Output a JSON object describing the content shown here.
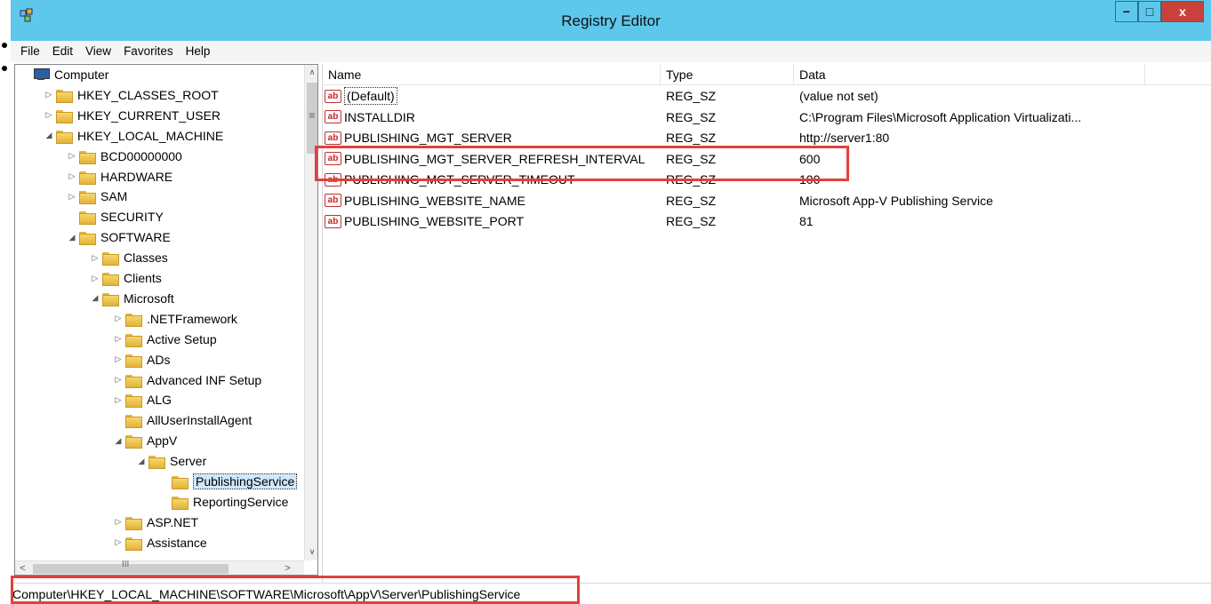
{
  "window": {
    "title": "Registry Editor",
    "minimize": "−",
    "maximize": "□",
    "close": "x",
    "accent_color": "#5ec8ec",
    "highlight_color": "#e2403b"
  },
  "menu": [
    "File",
    "Edit",
    "View",
    "Favorites",
    "Help"
  ],
  "tree": [
    {
      "label": "Computer",
      "level": 0,
      "expander": "",
      "icon": "computer-icon"
    },
    {
      "label": "HKEY_CLASSES_ROOT",
      "level": 1,
      "expander": "▷",
      "icon": "folder-icon"
    },
    {
      "label": "HKEY_CURRENT_USER",
      "level": 1,
      "expander": "▷",
      "icon": "folder-icon"
    },
    {
      "label": "HKEY_LOCAL_MACHINE",
      "level": 1,
      "expander": "◢",
      "icon": "folder-icon"
    },
    {
      "label": "BCD00000000",
      "level": 2,
      "expander": "▷",
      "icon": "folder-icon"
    },
    {
      "label": "HARDWARE",
      "level": 2,
      "expander": "▷",
      "icon": "folder-icon"
    },
    {
      "label": "SAM",
      "level": 2,
      "expander": "▷",
      "icon": "folder-icon"
    },
    {
      "label": "SECURITY",
      "level": 2,
      "expander": "",
      "icon": "folder-icon"
    },
    {
      "label": "SOFTWARE",
      "level": 2,
      "expander": "◢",
      "icon": "folder-icon"
    },
    {
      "label": "Classes",
      "level": 3,
      "expander": "▷",
      "icon": "folder-icon"
    },
    {
      "label": "Clients",
      "level": 3,
      "expander": "▷",
      "icon": "folder-icon"
    },
    {
      "label": "Microsoft",
      "level": 3,
      "expander": "◢",
      "icon": "folder-icon"
    },
    {
      "label": ".NETFramework",
      "level": 4,
      "expander": "▷",
      "icon": "folder-icon"
    },
    {
      "label": "Active Setup",
      "level": 4,
      "expander": "▷",
      "icon": "folder-icon"
    },
    {
      "label": "ADs",
      "level": 4,
      "expander": "▷",
      "icon": "folder-icon"
    },
    {
      "label": "Advanced INF Setup",
      "level": 4,
      "expander": "▷",
      "icon": "folder-icon"
    },
    {
      "label": "ALG",
      "level": 4,
      "expander": "▷",
      "icon": "folder-icon"
    },
    {
      "label": "AllUserInstallAgent",
      "level": 4,
      "expander": "",
      "icon": "folder-icon"
    },
    {
      "label": "AppV",
      "level": 4,
      "expander": "◢",
      "icon": "folder-icon"
    },
    {
      "label": "Server",
      "level": 5,
      "expander": "◢",
      "icon": "folder-icon"
    },
    {
      "label": "PublishingService",
      "level": 6,
      "expander": "",
      "icon": "folder-icon",
      "selected": true
    },
    {
      "label": "ReportingService",
      "level": 6,
      "expander": "",
      "icon": "folder-icon"
    },
    {
      "label": "ASP.NET",
      "level": 4,
      "expander": "▷",
      "icon": "folder-icon"
    },
    {
      "label": "Assistance",
      "level": 4,
      "expander": "▷",
      "icon": "folder-icon"
    }
  ],
  "tree_scroll": {
    "up": "∧",
    "down": "∨",
    "left": "<",
    "right": ">",
    "grip_v": "≡",
    "grip_h": "III"
  },
  "list": {
    "columns": [
      "Name",
      "Type",
      "Data"
    ],
    "rows": [
      {
        "name": "(Default)",
        "type": "REG_SZ",
        "data": "(value not set)"
      },
      {
        "name": "INSTALLDIR",
        "type": "REG_SZ",
        "data": "C:\\Program Files\\Microsoft Application Virtualizati..."
      },
      {
        "name": "PUBLISHING_MGT_SERVER",
        "type": "REG_SZ",
        "data": "http://server1:80"
      },
      {
        "name": "PUBLISHING_MGT_SERVER_REFRESH_INTERVAL",
        "type": "REG_SZ",
        "data": "600"
      },
      {
        "name": "PUBLISHING_MGT_SERVER_TIMEOUT",
        "type": "REG_SZ",
        "data": "100"
      },
      {
        "name": "PUBLISHING_WEBSITE_NAME",
        "type": "REG_SZ",
        "data": "Microsoft App-V Publishing Service"
      },
      {
        "name": "PUBLISHING_WEBSITE_PORT",
        "type": "REG_SZ",
        "data": "81"
      }
    ],
    "value_icon_text": "ab"
  },
  "status": {
    "path": "Computer\\HKEY_LOCAL_MACHINE\\SOFTWARE\\Microsoft\\AppV\\Server\\PublishingService"
  }
}
